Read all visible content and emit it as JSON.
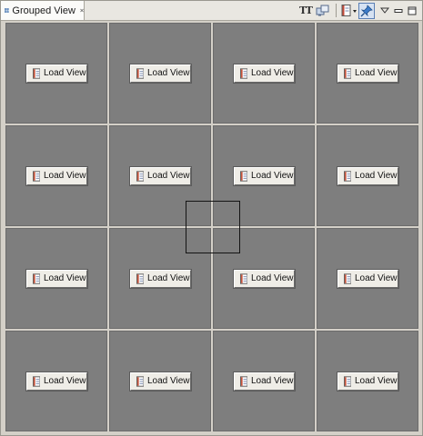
{
  "tab": {
    "title": "Grouped View",
    "icon": "grid-view-icon",
    "close_icon": "close-icon"
  },
  "toolbar": {
    "text_tool_label": "TT",
    "items": [
      "text-size-icon",
      "sync-icon",
      "page-dropdown-icon",
      "pin-icon",
      "view-menu-icon",
      "minimize-icon",
      "maximize-icon"
    ]
  },
  "grid": {
    "rows": 4,
    "columns": 4,
    "background_color": "#7e7e7e",
    "cells": [
      {
        "button_label": "Load View"
      },
      {
        "button_label": "Load View"
      },
      {
        "button_label": "Load View"
      },
      {
        "button_label": "Load View"
      },
      {
        "button_label": "Load View"
      },
      {
        "button_label": "Load View"
      },
      {
        "button_label": "Load View"
      },
      {
        "button_label": "Load View"
      },
      {
        "button_label": "Load View"
      },
      {
        "button_label": "Load View"
      },
      {
        "button_label": "Load View"
      },
      {
        "button_label": "Load View"
      },
      {
        "button_label": "Load View"
      },
      {
        "button_label": "Load View"
      },
      {
        "button_label": "Load View"
      },
      {
        "button_label": "Load View"
      }
    ],
    "button_icon": "document-icon"
  }
}
